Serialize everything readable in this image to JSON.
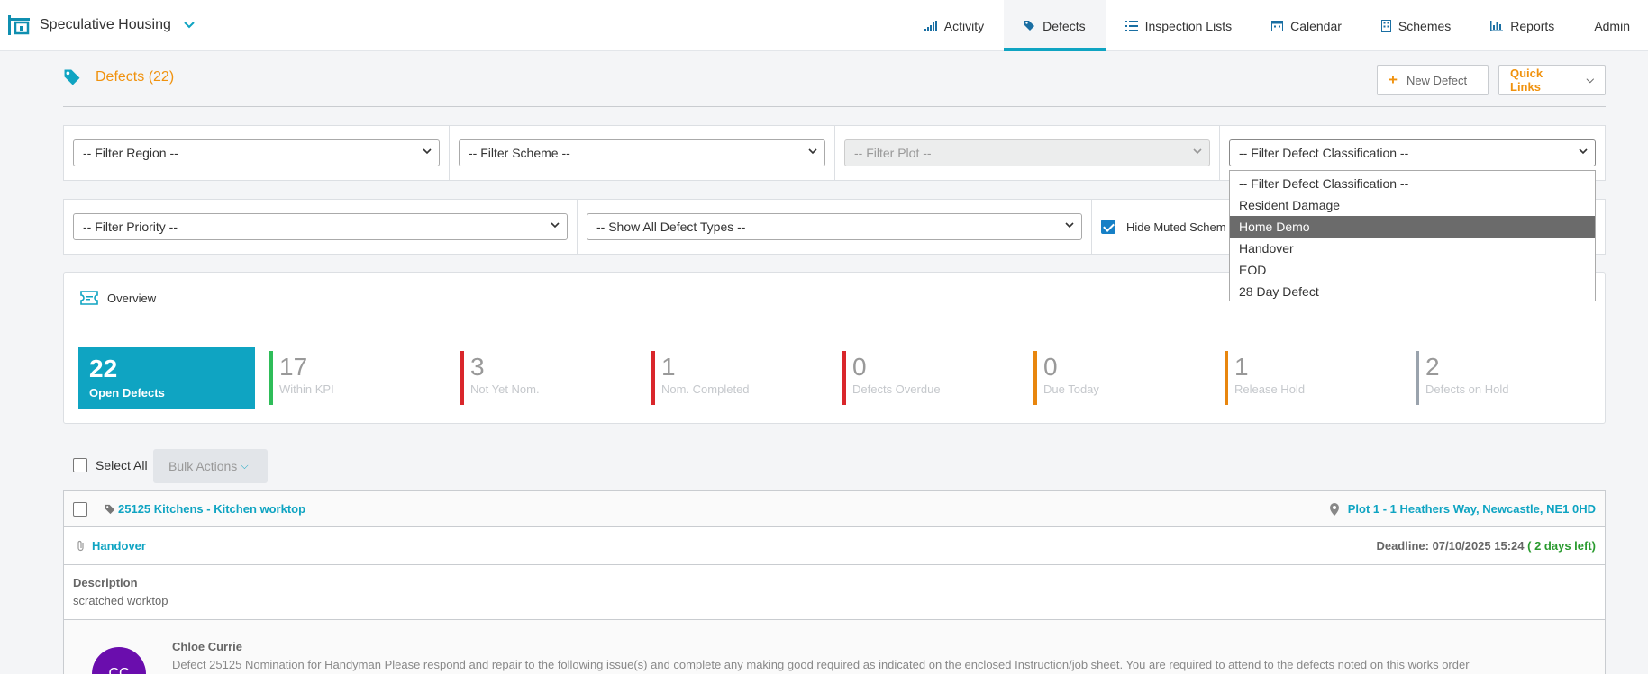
{
  "app": {
    "name": "Speculative Housing"
  },
  "nav": [
    {
      "label": "Activity",
      "icon": "bar-chart-icon"
    },
    {
      "label": "Defects",
      "icon": "tag-icon",
      "active": true
    },
    {
      "label": "Inspection Lists",
      "icon": "list-icon"
    },
    {
      "label": "Calendar",
      "icon": "calendar-icon"
    },
    {
      "label": "Schemes",
      "icon": "building-icon"
    },
    {
      "label": "Reports",
      "icon": "chart-icon"
    },
    {
      "label": "Admin"
    }
  ],
  "page": {
    "title": "Defects (22)"
  },
  "actions": {
    "new_defect": "New Defect",
    "quick_links": "Quick Links"
  },
  "filters": {
    "region": "-- Filter Region --",
    "scheme": "-- Filter Scheme --",
    "plot": "-- Filter Plot --",
    "classification": "-- Filter Defect Classification --",
    "priority": "-- Filter Priority --",
    "types": "-- Show All Defect Types --",
    "hide_muted": "Hide Muted Schem"
  },
  "classification_options": [
    "-- Filter Defect Classification --",
    "Resident Damage",
    "Home Demo",
    "Handover",
    "EOD",
    "28 Day Defect"
  ],
  "classification_highlighted": "Home Demo",
  "overview": {
    "title": "Overview",
    "main": {
      "value": "22",
      "label": "Open Defects"
    },
    "stats": [
      {
        "value": "17",
        "label": "Within KPI",
        "color": "#2ebd59"
      },
      {
        "value": "3",
        "label": "Not Yet Nom.",
        "color": "#d9262b"
      },
      {
        "value": "1",
        "label": "Nom. Completed",
        "color": "#d9262b"
      },
      {
        "value": "0",
        "label": "Defects Overdue",
        "color": "#d9262b"
      },
      {
        "value": "0",
        "label": "Due Today",
        "color": "#e8860e"
      },
      {
        "value": "1",
        "label": "Release Hold",
        "color": "#e8860e"
      },
      {
        "value": "2",
        "label": "Defects on Hold",
        "color": "#9aa3ad"
      }
    ]
  },
  "bulk": {
    "select_all": "Select All",
    "bulk_actions": "Bulk Actions"
  },
  "defect": {
    "title": "25125 Kitchens - Kitchen worktop",
    "location": "Plot 1 - 1 Heathers Way, Newcastle, NE1 0HD",
    "classification": "Handover",
    "deadline_label": "Deadline: 07/10/2025 15:24",
    "days_left": "( 2 days left)",
    "description_label": "Description",
    "description": "scratched worktop",
    "comment_author": "Chloe Currie",
    "comment_text": "Defect 25125 Nomination for Handyman Please respond and repair to the following issue(s) and complete any making good required as indicated on the enclosed Instruction/job sheet. You are required to attend to the defects noted on this works order",
    "avatar_text": "CC"
  }
}
